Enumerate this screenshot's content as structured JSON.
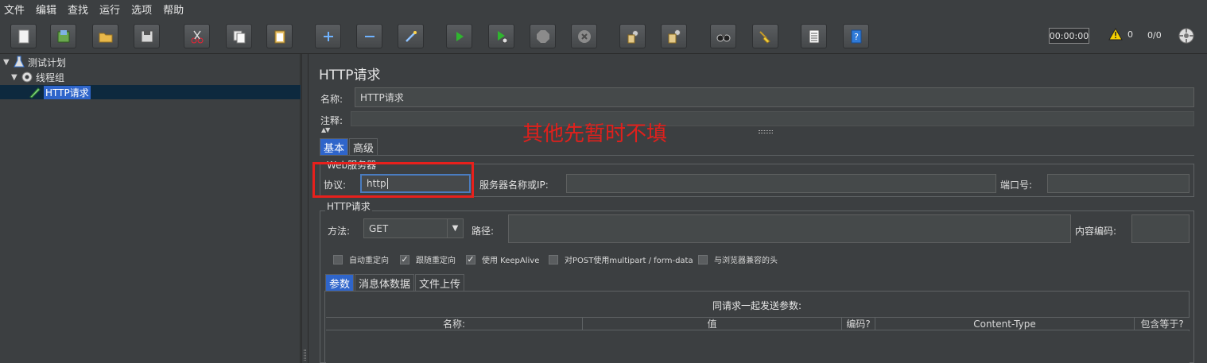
{
  "menu": [
    "文件",
    "编辑",
    "查找",
    "运行",
    "选项",
    "帮助"
  ],
  "toolbar": {
    "buttons": [
      "new-icon",
      "templates-icon",
      "open-icon",
      "save-icon",
      "cut-icon",
      "copy-icon",
      "paste-icon",
      "expand-icon",
      "collapse-icon",
      "toggle-icon",
      "start-icon",
      "start-no-pause-icon",
      "stop-icon",
      "shutdown-icon",
      "clear-icon",
      "clear-all-icon",
      "search-icon",
      "reset-search-icon",
      "function-helper-icon",
      "help-icon"
    ],
    "timer": "00:00:00",
    "warning_count": "0",
    "threads": "0/0"
  },
  "tree": {
    "plan": "测试计划",
    "thread_group": "线程组",
    "sampler": "HTTP请求"
  },
  "panel": {
    "title": "HTTP请求",
    "name_label": "名称:",
    "name_value": "HTTP请求",
    "comment_label": "注释:",
    "annotation": "其他先暂时不填",
    "tabs": [
      "基本",
      "高级"
    ],
    "web_server": {
      "title": "Web服务器",
      "protocol_label": "协议:",
      "protocol_value": "http",
      "server_label": "服务器名称或IP:",
      "port_label": "端口号:"
    },
    "http_request": {
      "title": "HTTP请求",
      "method_label": "方法:",
      "method_value": "GET",
      "path_label": "路径:",
      "encoding_label": "内容编码:"
    },
    "checkboxes": [
      {
        "label": "自动重定向",
        "checked": false
      },
      {
        "label": "跟随重定向",
        "checked": true
      },
      {
        "label": "使用 KeepAlive",
        "checked": true
      },
      {
        "label": "对POST使用multipart / form-data",
        "checked": false
      },
      {
        "label": "与浏览器兼容的头",
        "checked": false
      }
    ],
    "sub_tabs": [
      "参数",
      "消息体数据",
      "文件上传"
    ],
    "params": {
      "caption": "同请求一起发送参数:",
      "columns": [
        "名称:",
        "值",
        "编码?",
        "Content-Type",
        "包含等于?"
      ]
    }
  }
}
